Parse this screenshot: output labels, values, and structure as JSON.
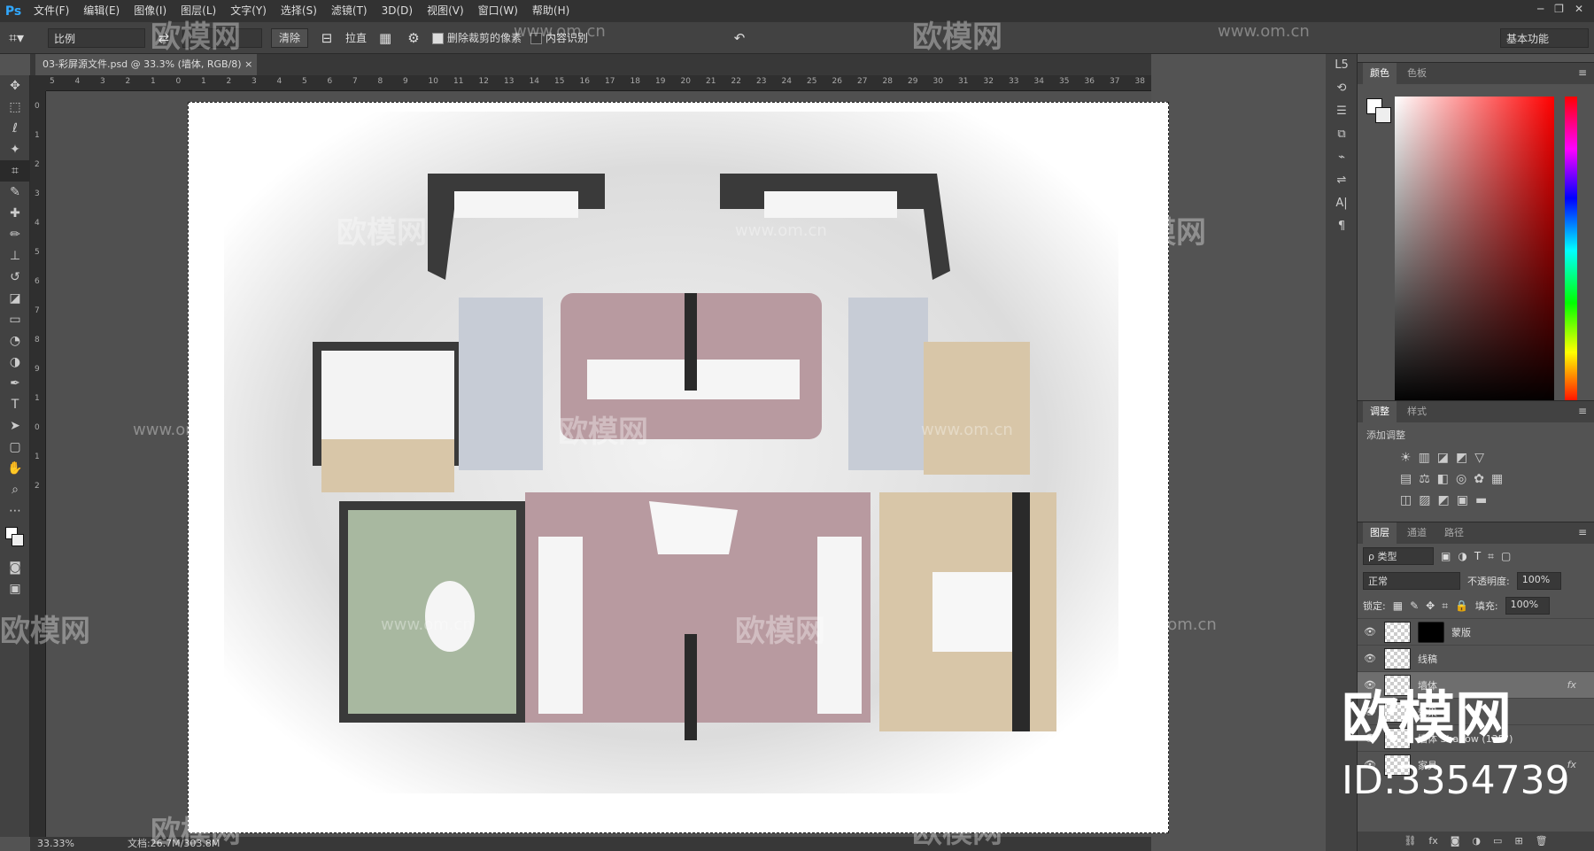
{
  "app": {
    "logo": "Ps"
  },
  "menu": [
    "文件(F)",
    "编辑(E)",
    "图像(I)",
    "图层(L)",
    "文字(Y)",
    "选择(S)",
    "滤镜(T)",
    "3D(D)",
    "视图(V)",
    "窗口(W)",
    "帮助(H)"
  ],
  "options": {
    "ratio": "比例",
    "clear": "清除",
    "straighten": "拉直",
    "delete_cropped": "删除裁剪的像素",
    "content_aware": "内容识别",
    "workspace": "基本功能"
  },
  "document": {
    "tab_title": "03-彩屏源文件.psd @ 33.3% (墙体, RGB/8)"
  },
  "ruler": {
    "h": [
      "5",
      "4",
      "3",
      "2",
      "1",
      "0",
      "1",
      "2",
      "3",
      "4",
      "5",
      "6",
      "7",
      "8",
      "9",
      "10",
      "11",
      "12",
      "13",
      "14",
      "15",
      "16",
      "17",
      "18",
      "19",
      "20",
      "21",
      "22",
      "23",
      "24",
      "25",
      "26",
      "27",
      "28",
      "29",
      "30",
      "31",
      "32",
      "33",
      "34",
      "35",
      "36",
      "37",
      "38"
    ],
    "v": [
      "0",
      "1",
      "2",
      "3",
      "4",
      "5",
      "6",
      "7",
      "8",
      "9",
      "1",
      "0",
      "1",
      "2"
    ]
  },
  "status": {
    "zoom": "33.33%",
    "doc": "文档:26.7M/303.8M"
  },
  "panels": {
    "color_tabs": [
      "颜色",
      "色板"
    ],
    "adjust_tabs": [
      "调整",
      "样式"
    ],
    "adjust_label": "添加调整",
    "layer_tabs": [
      "图层",
      "通道",
      "路径"
    ],
    "kind": "ρ 类型",
    "blend": "正常",
    "opacity_label": "不透明度:",
    "opacity": "100%",
    "lock_label": "锁定:",
    "fill_label": "填充:",
    "fill": "100%"
  },
  "layers": [
    {
      "name": "蒙版",
      "fx": ""
    },
    {
      "name": "线稿",
      "fx": ""
    },
    {
      "name": "墙体",
      "fx": "fx"
    },
    {
      "name": "效果",
      "fx": ""
    },
    {
      "name": "墙体 Shadow (135°)",
      "fx": ""
    },
    {
      "name": "",
      "fx": ""
    },
    {
      "name": "家具",
      "fx": "fx"
    },
    {
      "name": "shadow",
      "fx": ""
    }
  ],
  "watermarks": {
    "brand": "欧模网",
    "url": "www.om.cn",
    "big": "欧模网",
    "id": "ID:3354739"
  }
}
